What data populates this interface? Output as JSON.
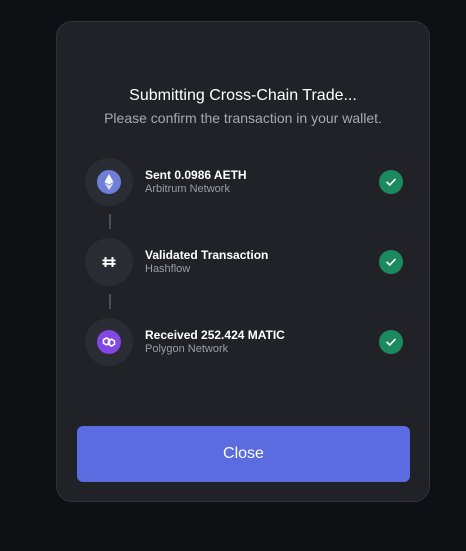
{
  "modal": {
    "title": "Submitting Cross-Chain Trade...",
    "subtitle": "Please confirm the transaction in your wallet.",
    "close_label": "Close"
  },
  "steps": [
    {
      "title": "Sent 0.0986 AETH",
      "subtitle": "Arbitrum Network",
      "icon": "ethereum-icon",
      "status": "complete"
    },
    {
      "title": "Validated Transaction",
      "subtitle": "Hashflow",
      "icon": "hashflow-icon",
      "status": "complete"
    },
    {
      "title": "Received 252.424 MATIC",
      "subtitle": "Polygon Network",
      "icon": "polygon-icon",
      "status": "complete"
    }
  ],
  "colors": {
    "modal_bg": "#202228",
    "accent": "#5b6be0",
    "success": "#1b8a5f",
    "ethereum": "#6f7fd8",
    "polygon": "#8247e5"
  }
}
